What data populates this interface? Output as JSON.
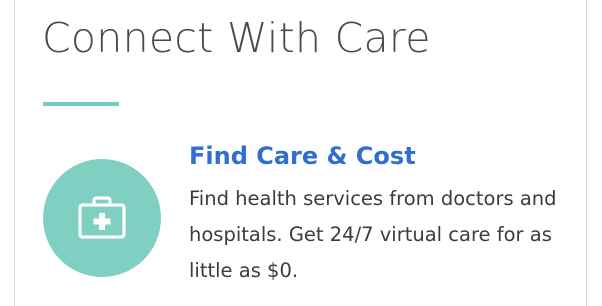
{
  "section": {
    "title": "Connect With Care"
  },
  "card": {
    "icon": "medical-kit-icon",
    "title": "Find Care & Cost",
    "description": "Find health services from doctors and hospitals. Get 24/7 virtual care for as little as $0."
  },
  "colors": {
    "accent": "#72cdbf",
    "icon_circle": "#7fcfc2",
    "link_title": "#2f6fcf",
    "body_text": "#3c3c3c"
  }
}
